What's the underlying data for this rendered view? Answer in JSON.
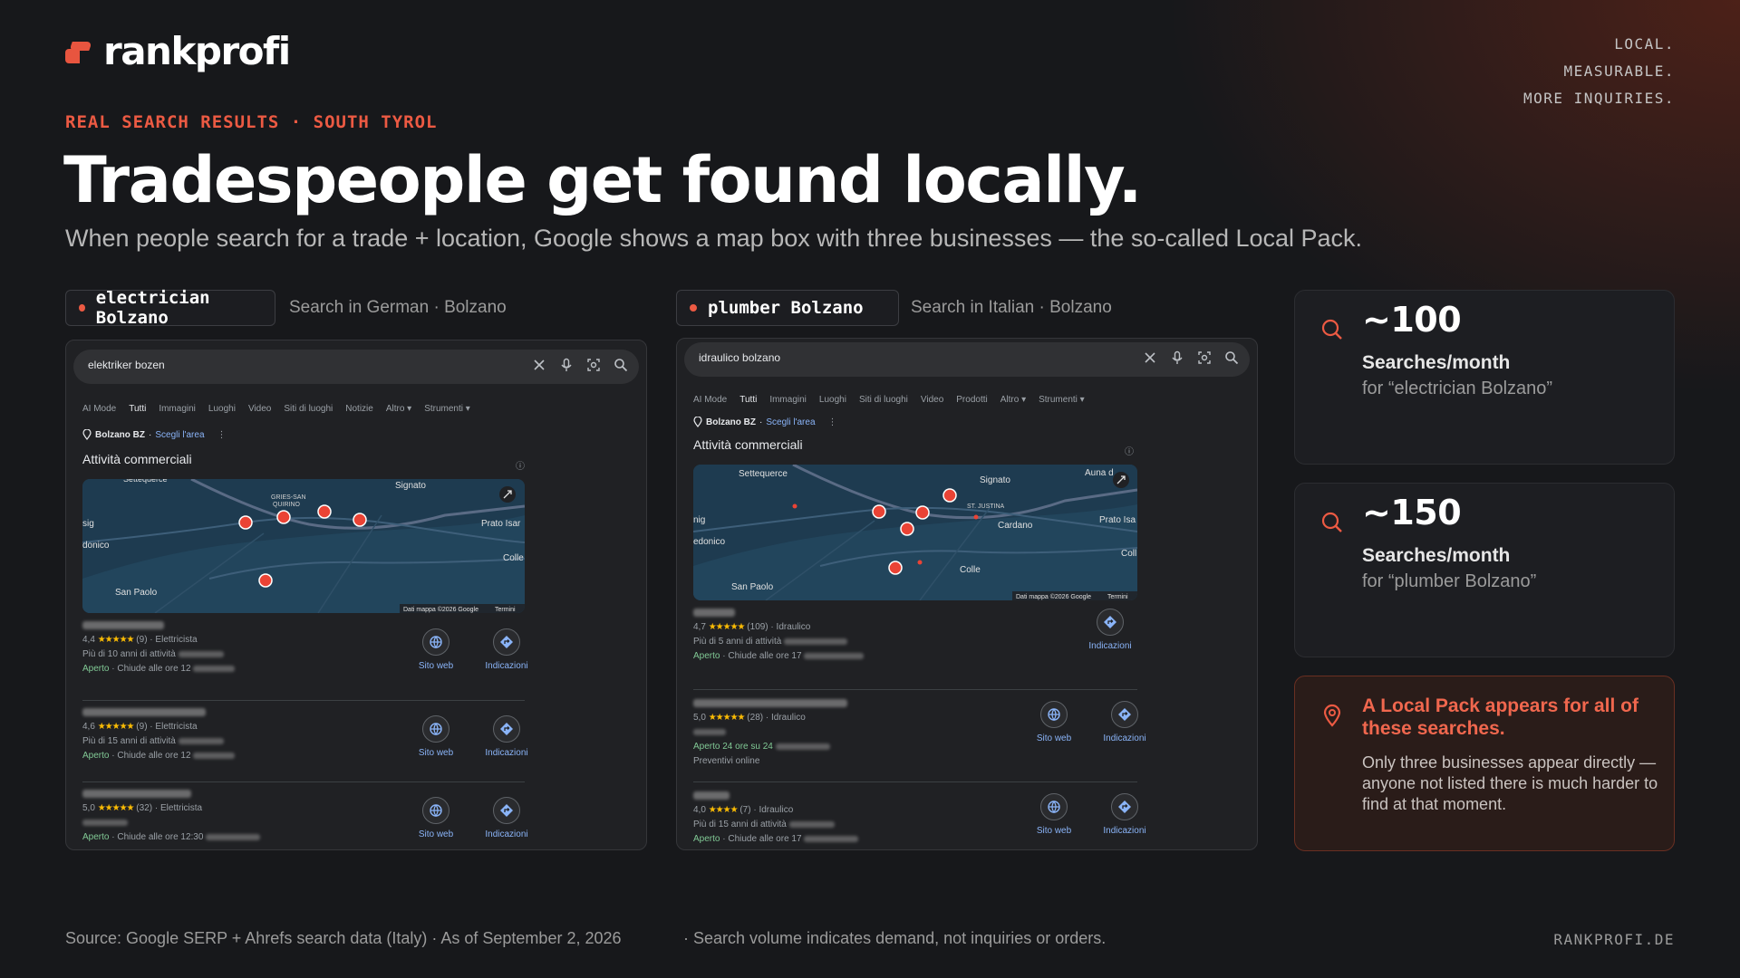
{
  "brand": {
    "name": "rankprofi"
  },
  "tagline": [
    "LOCAL.",
    "MEASURABLE.",
    "MORE INQUIRIES."
  ],
  "eyebrow": "REAL SEARCH RESULTS · SOUTH TYROL",
  "headline": "Tradespeople get found locally.",
  "subline": "When people search for a trade + location, Google shows a map box with three businesses — the so-called Local Pack.",
  "colors": {
    "accent": "#ec5a43",
    "background": "#17181b",
    "star": "#fbbc04",
    "open": "#81c995",
    "link": "#8ab4f8"
  },
  "icons": {
    "search_bar": [
      "close-icon",
      "microphone-icon",
      "lens-icon",
      "search-icon"
    ],
    "actions": [
      "globe-icon",
      "directions-icon"
    ],
    "cards": [
      "search-icon",
      "map-pin-icon"
    ]
  },
  "panels": [
    {
      "chip": "electrician Bolzano",
      "meta": "Search in German · Bolzano",
      "serp": {
        "query": "elektriker bozen",
        "tabs": [
          "AI Mode",
          "Tutti",
          "Immagini",
          "Luoghi",
          "Video",
          "Siti di luoghi",
          "Notizie",
          "Altro ▾",
          "Strumenti ▾"
        ],
        "active_tab": "Tutti",
        "location": "Bolzano BZ",
        "location_link": "Scegli l'area",
        "section": "Attività commerciali",
        "map_labels": [
          "Settequerce",
          "Signato",
          "GRIES-SAN QUIRINO",
          "Prato Isar",
          "sig",
          "donico",
          "Colle",
          "San Paolo"
        ],
        "map_credit": "Dati mappa ©2026 Google",
        "map_terms": "Termini",
        "listings": [
          {
            "rating": "4,4",
            "stars": "★★★★★",
            "reviews": "(9)",
            "category": "Elettricista",
            "line2": "Più di 10 anni di attività",
            "open": "Aperto",
            "hours": "· Chiude alle ore 12",
            "website_label": "Sito web",
            "directions_label": "Indicazioni"
          },
          {
            "rating": "4,6",
            "stars": "★★★★★",
            "reviews": "(9)",
            "category": "Elettricista",
            "line2": "Più di 15 anni di attività",
            "open": "Aperto",
            "hours": "· Chiude alle ore 12",
            "website_label": "Sito web",
            "directions_label": "Indicazioni"
          },
          {
            "rating": "5,0",
            "stars": "★★★★★",
            "reviews": "(32)",
            "category": "Elettricista",
            "line2": "",
            "open": "Aperto",
            "hours": "· Chiude alle ore 12:30",
            "website_label": "Sito web",
            "directions_label": "Indicazioni"
          }
        ]
      }
    },
    {
      "chip": "plumber Bolzano",
      "meta": "Search in Italian · Bolzano",
      "serp": {
        "query": "idraulico bolzano",
        "tabs": [
          "AI Mode",
          "Tutti",
          "Immagini",
          "Luoghi",
          "Siti di luoghi",
          "Video",
          "Prodotti",
          "Altro ▾",
          "Strumenti ▾"
        ],
        "active_tab": "Tutti",
        "location": "Bolzano BZ",
        "location_link": "Scegli l'area",
        "section": "Attività commerciali",
        "map_labels": [
          "Settequerce",
          "Signato",
          "Auna d",
          "ST. JUSTINA",
          "Cardano",
          "Prato Isa",
          "nig",
          "edonico",
          "Colle",
          "San Paolo",
          "Coll"
        ],
        "map_credit": "Dati mappa ©2026 Google",
        "map_terms": "Termini",
        "listings": [
          {
            "rating": "4,7",
            "stars": "★★★★★",
            "reviews": "(109)",
            "category": "Idraulico",
            "line2": "Più di 5 anni di attività",
            "line3": "",
            "open": "Aperto",
            "hours": "· Chiude alle ore 17",
            "website_label": "",
            "directions_label": "Indicazioni"
          },
          {
            "rating": "5,0",
            "stars": "★★★★★",
            "reviews": "(28)",
            "category": "Idraulico",
            "line2": "",
            "line3": "Preventivi online",
            "open": "Aperto 24 ore su 24",
            "hours": "",
            "website_label": "Sito web",
            "directions_label": "Indicazioni"
          },
          {
            "rating": "4,0",
            "stars": "★★★★",
            "reviews": "(7)",
            "category": "Idraulico",
            "line2": "Più di 15 anni di attività",
            "line3": "",
            "open": "Aperto",
            "hours": "· Chiude alle ore 17",
            "website_label": "Sito web",
            "directions_label": "Indicazioni"
          }
        ]
      }
    }
  ],
  "stats": [
    {
      "value": "~100",
      "label": "Searches/month",
      "sub": "for “electrician Bolzano”"
    },
    {
      "value": "~150",
      "label": "Searches/month",
      "sub": "for “plumber Bolzano”"
    }
  ],
  "highlight": {
    "title": "A Local Pack appears for all of these searches.",
    "body": "Only three businesses appear directly — anyone not listed there is much harder to find at that moment."
  },
  "footer": {
    "source": "Source: Google SERP + Ahrefs search data (Italy) · As of September 2, 2026",
    "note": "· Search volume indicates demand, not inquiries or orders.",
    "domain": "RANKPROFI.DE"
  }
}
